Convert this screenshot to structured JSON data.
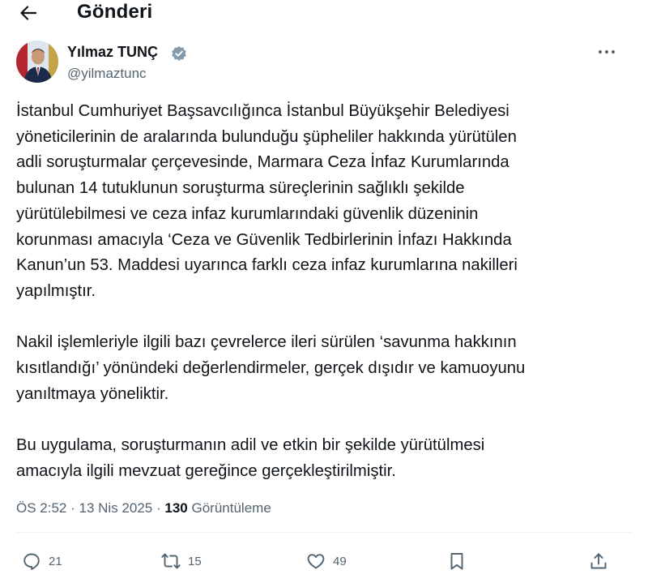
{
  "header": {
    "title": "Gönderi",
    "back_icon": "arrow-left-icon"
  },
  "author": {
    "name": "Yılmaz TUNÇ",
    "handle": "@yilmaztunc",
    "verified": true,
    "verified_color": "#829aab"
  },
  "tweet": {
    "paragraphs": [
      [
        "İstanbul Cumhuriyet Başsavcılığınca İstanbul Büyükşehir Belediyesi",
        "yöneticilerinin de aralarında bulunduğu şüpheliler hakkında yürütülen",
        "adli soruşturmalar çerçevesinde, Marmara Ceza İnfaz Kurumlarında",
        "bulunan 14 tutuklunun soruşturma süreçlerinin sağlıklı şekilde",
        "yürütülebilmesi ve ceza infaz kurumlarındaki güvenlik düzeninin",
        "korunması amacıyla ‘Ceza ve Güvenlik Tedbirlerinin İnfazı Hakkında",
        "Kanun’un 53. Maddesi uyarınca farklı ceza infaz kurumlarına nakilleri",
        "yapılmıştır."
      ],
      [
        "Nakil işlemleriyle ilgili bazı çevrelerce ileri sürülen ‘savunma hakkının",
        "kısıtlandığı’ yönündeki değerlendirmeler, gerçek dışıdır ve kamuoyunu",
        "yanıltmaya yöneliktir."
      ],
      [
        "Bu uygulama, soruşturmanın adil ve etkin bir şekilde yürütülmesi",
        "amacıyla ilgili mevzuat gereğince gerçekleştirilmiştir."
      ]
    ]
  },
  "meta": {
    "time": "ÖS 2:52",
    "separator": "·",
    "date": "13 Nis 2025",
    "views_count": "130",
    "views_label": "Görüntüleme"
  },
  "actions": {
    "reply": {
      "icon": "reply-icon",
      "count": "21"
    },
    "repost": {
      "icon": "repost-icon",
      "count": "15"
    },
    "like": {
      "icon": "heart-icon",
      "count": "49"
    },
    "bookmark": {
      "icon": "bookmark-icon"
    },
    "share": {
      "icon": "share-icon"
    }
  },
  "colors": {
    "text": "#0f1419",
    "secondary": "#536471",
    "divider": "#eff3f4"
  }
}
